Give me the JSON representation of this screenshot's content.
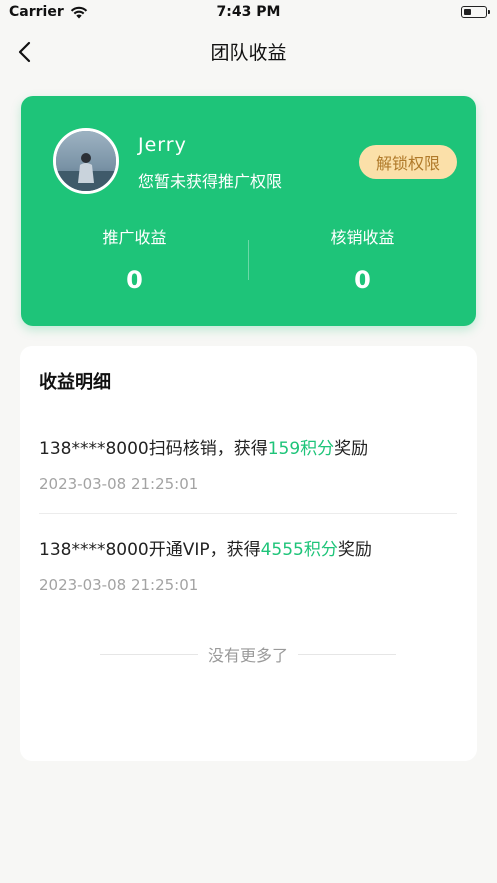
{
  "status_bar": {
    "carrier": "Carrier",
    "time": "7:43 PM",
    "battery_level": 0.35
  },
  "nav": {
    "title": "团队收益"
  },
  "profile": {
    "name": "Jerry",
    "description": "您暂未获得推广权限",
    "unlock_label": "解锁权限"
  },
  "stats": {
    "promo_label": "推广收益",
    "promo_value": "0",
    "verify_label": "核销收益",
    "verify_value": "0"
  },
  "details": {
    "title": "收益明细",
    "records": [
      {
        "prefix": "138****8000扫码核销，获得",
        "highlight": "159积分",
        "suffix": "奖励",
        "time": "2023-03-08 21:25:01"
      },
      {
        "prefix": "138****8000开通VIP，获得",
        "highlight": "4555积分",
        "suffix": "奖励",
        "time": "2023-03-08 21:25:01"
      }
    ],
    "no_more": "没有更多了"
  },
  "colors": {
    "accent": "#1ec479",
    "unlock_bg": "#fbe0a9",
    "unlock_text": "#b07a2a"
  }
}
